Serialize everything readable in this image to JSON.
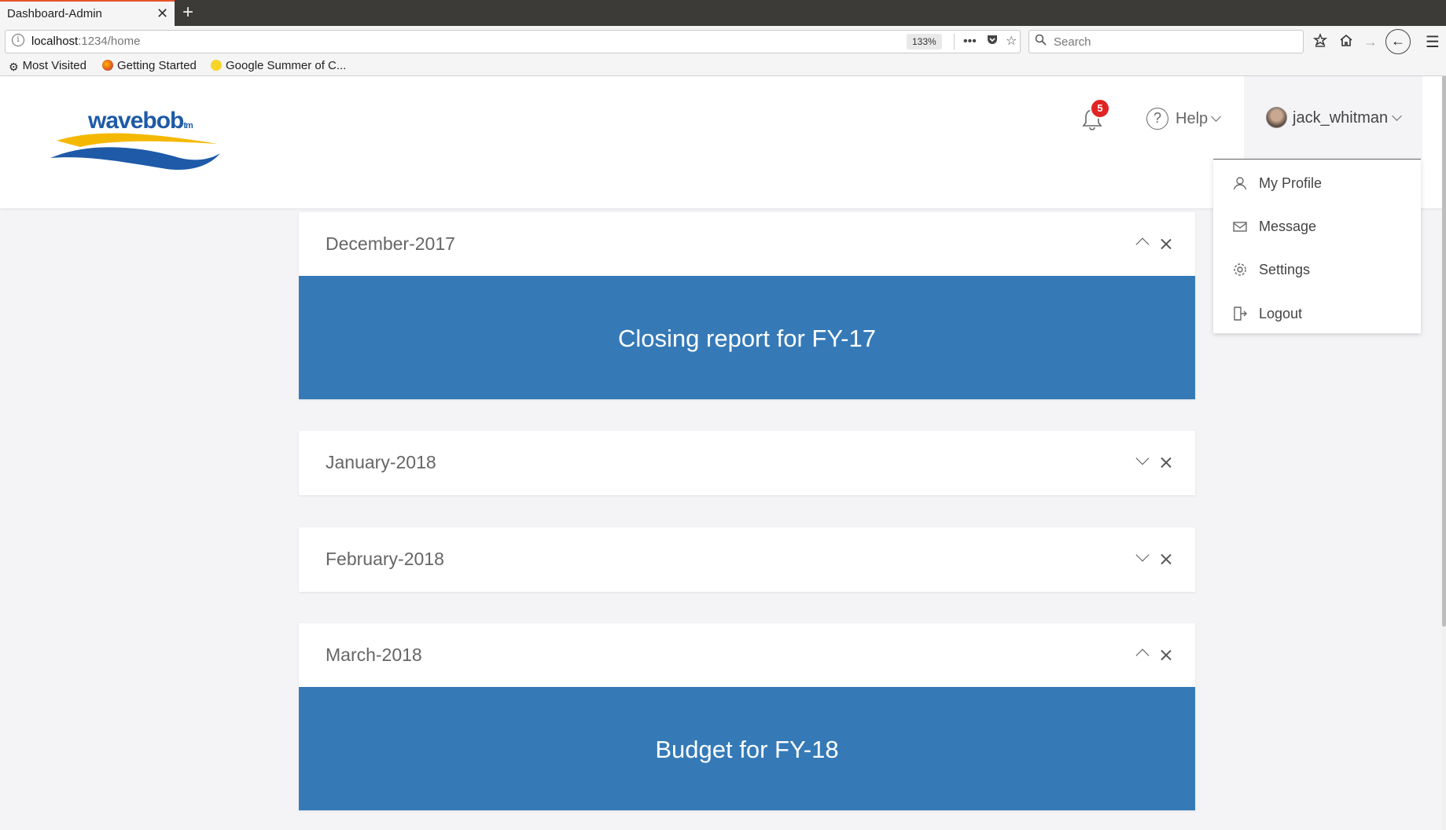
{
  "browser": {
    "tab_title": "Dashboard-Admin",
    "tab_close": "✕",
    "new_tab": "+",
    "url_host": "localhost",
    "url_path": ":1234/home",
    "zoom": "133%",
    "search_placeholder": "Search",
    "bookmarks": [
      "Most Visited",
      "Getting Started",
      "Google Summer of C..."
    ]
  },
  "header": {
    "logo_text": "wavebob",
    "logo_tm": "tm",
    "notification_count": "5",
    "help_label": "Help",
    "user_name": "jack_whitman"
  },
  "user_menu": {
    "items": [
      {
        "label": "My Profile",
        "icon": "user-icon"
      },
      {
        "label": "Message",
        "icon": "envelope-icon"
      },
      {
        "label": "Settings",
        "icon": "gear-icon"
      },
      {
        "label": "Logout",
        "icon": "logout-icon"
      }
    ]
  },
  "cards": [
    {
      "title": "December-2017",
      "expanded": true,
      "body": "Closing report for FY-17"
    },
    {
      "title": "January-2018",
      "expanded": false,
      "body": ""
    },
    {
      "title": "February-2018",
      "expanded": false,
      "body": ""
    },
    {
      "title": "March-2018",
      "expanded": true,
      "body": "Budget for FY-18"
    }
  ],
  "colors": {
    "accent": "#357ab7",
    "badge": "#e02424",
    "logo_blue": "#1e5aa8",
    "logo_yellow": "#f5b800"
  }
}
